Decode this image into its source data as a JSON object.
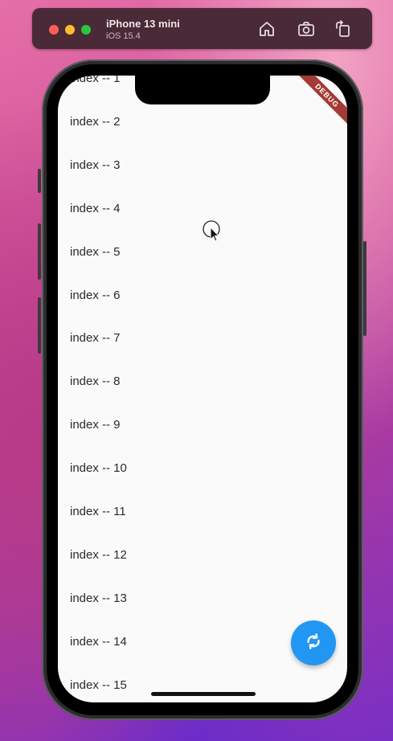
{
  "simulator": {
    "device_name": "iPhone 13 mini",
    "os_version": "iOS 15.4",
    "toolbar_icons": [
      "home-icon",
      "screenshot-icon",
      "rotate-icon"
    ]
  },
  "app": {
    "debug_banner": "DEBUG",
    "list_items": [
      "index -- 1",
      "index -- 2",
      "index -- 3",
      "index -- 4",
      "index -- 5",
      "index -- 6",
      "index -- 7",
      "index -- 8",
      "index -- 9",
      "index -- 10",
      "index -- 11",
      "index -- 12",
      "index -- 13",
      "index -- 14",
      "index -- 15"
    ],
    "fab_icon": "refresh-icon",
    "accent_color": "#2196f3"
  }
}
